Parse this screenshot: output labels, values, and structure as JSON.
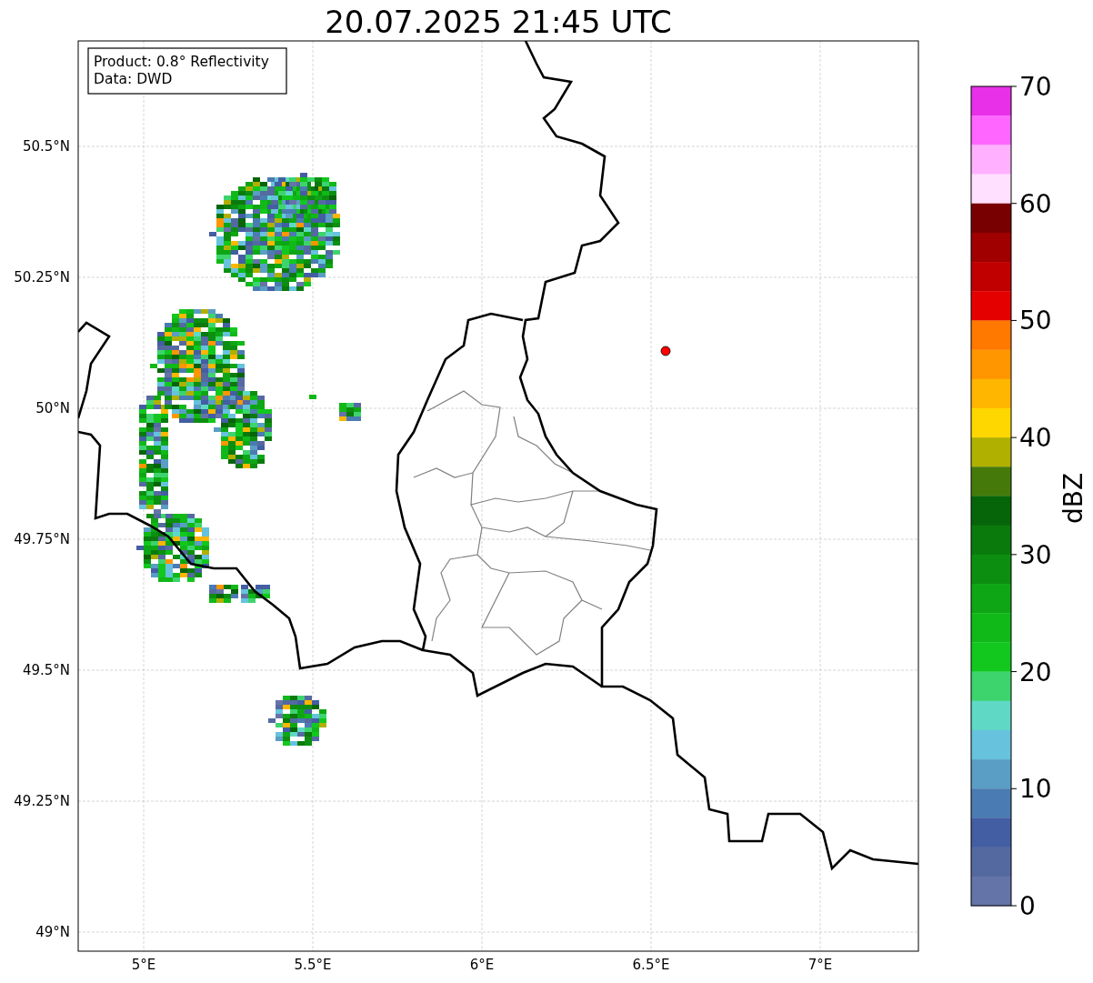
{
  "title": "20.07.2025 21:45 UTC",
  "info_box": [
    "Product: 0.8° Reflectivity",
    "Data: DWD"
  ],
  "map": {
    "x_ticks": [
      "5°E",
      "5.5°E",
      "6°E",
      "6.5°E",
      "7°E"
    ],
    "y_ticks": [
      "50.5°N",
      "50.25°N",
      "50°N",
      "49.75°N",
      "49.5°N",
      "49.25°N",
      "49°N"
    ]
  },
  "colorbar": {
    "label": "dBZ",
    "ticks": [
      "70",
      "60",
      "50",
      "40",
      "30",
      "20",
      "10",
      "0"
    ],
    "bins": [
      {
        "color": "#e830e8"
      },
      {
        "color": "#ff66ff"
      },
      {
        "color": "#ffb0ff"
      },
      {
        "color": "#ffe0ff"
      },
      {
        "color": "#780000"
      },
      {
        "color": "#a00000"
      },
      {
        "color": "#c00000"
      },
      {
        "color": "#e50000"
      },
      {
        "color": "#ff7800"
      },
      {
        "color": "#ff9600"
      },
      {
        "color": "#ffb600"
      },
      {
        "color": "#ffd700"
      },
      {
        "color": "#b0b000"
      },
      {
        "color": "#457a0a"
      },
      {
        "color": "#066409"
      },
      {
        "color": "#0a7a0d"
      },
      {
        "color": "#0c8f10"
      },
      {
        "color": "#0ea614"
      },
      {
        "color": "#10b818"
      },
      {
        "color": "#12c81e"
      },
      {
        "color": "#3dd46e"
      },
      {
        "color": "#5fd8c6"
      },
      {
        "color": "#66c2dd"
      },
      {
        "color": "#5a9dc5"
      },
      {
        "color": "#4a7bb2"
      },
      {
        "color": "#435ea2"
      },
      {
        "color": "#5569a1"
      },
      {
        "color": "#6574a8"
      }
    ]
  }
}
